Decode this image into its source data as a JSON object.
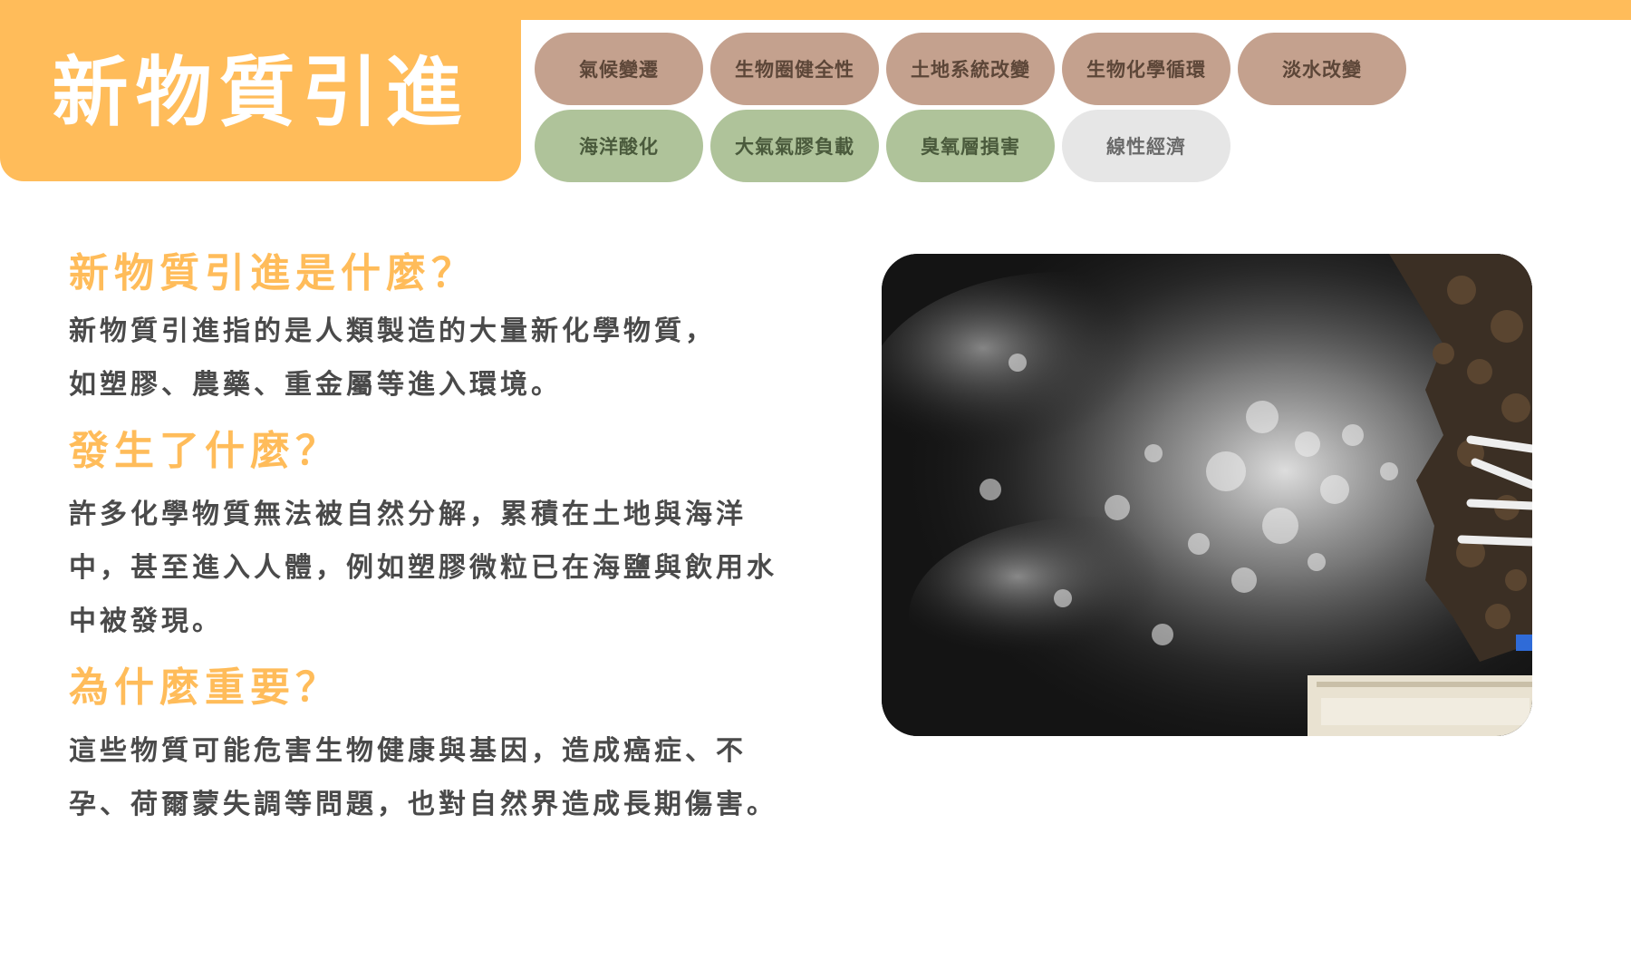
{
  "header": {
    "title": "新物質引進"
  },
  "nav": {
    "row1": [
      {
        "label": "氣候變遷",
        "color": "#c4a18e"
      },
      {
        "label": "生物圈健全性",
        "color": "#c4a18e"
      },
      {
        "label": "土地系統改變",
        "color": "#c4a18e"
      },
      {
        "label": "生物化學循環",
        "color": "#c4a18e"
      },
      {
        "label": "淡水改變",
        "color": "#c4a18e"
      }
    ],
    "row2": [
      {
        "label": "海洋酸化",
        "color": "#afc39a"
      },
      {
        "label": "大氣氣膠負載",
        "color": "#afc39a"
      },
      {
        "label": "臭氧層損害",
        "color": "#afc39a"
      },
      {
        "label": "線性經濟",
        "color": "#e6e6e6"
      }
    ]
  },
  "content": {
    "sections": [
      {
        "heading": "新物質引進是什麼？",
        "lines": [
          "新物質引進指的是人類製造的大量新化學物質，",
          "如塑膠、農藥、重金屬等進入環境。"
        ]
      },
      {
        "heading": "發生了什麼？",
        "lines": [
          "許多化學物質無法被自然分解，累積在土地與海洋",
          "中，甚至進入人體，例如塑膠微粒已在海鹽與飲用水",
          "中被發現。"
        ]
      },
      {
        "heading": "為什麼重要？",
        "lines": [
          "這些物質可能危害生物健康與基因，造成癌症、不",
          "孕、荷爾蒙失調等問題，也對自然界造成長期傷害。"
        ]
      }
    ]
  },
  "colors": {
    "accent": "#ffbc5a",
    "body_text": "#4a4a4a",
    "tag_brown": "#c4a18e",
    "tag_green": "#afc39a",
    "tag_grey": "#e6e6e6"
  }
}
